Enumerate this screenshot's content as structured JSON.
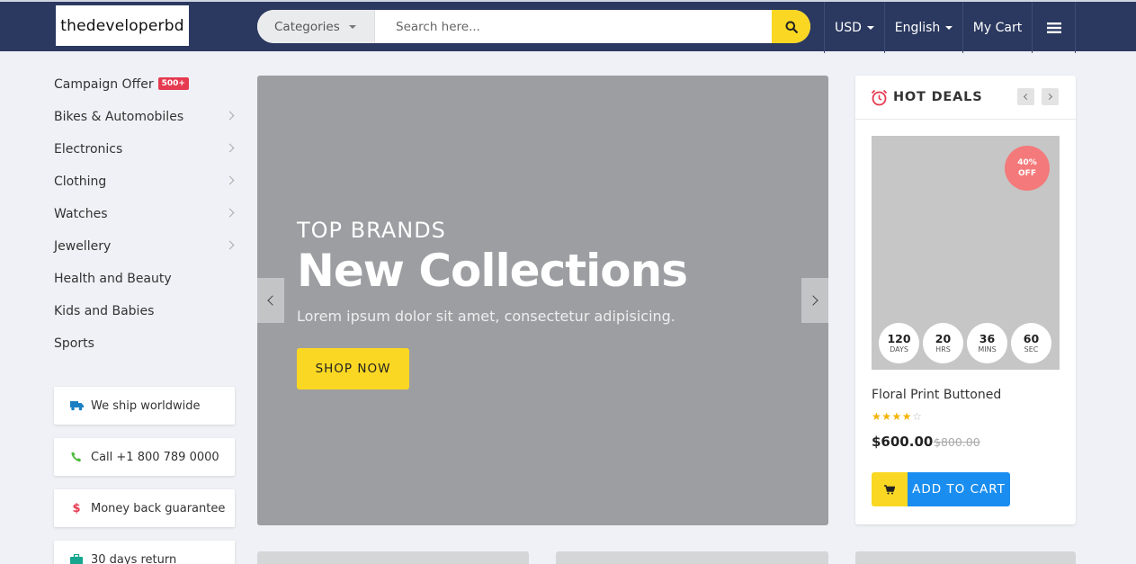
{
  "header": {
    "logo": "thedeveloperbd",
    "category_label": "Categories",
    "search_placeholder": "Search here...",
    "currency": "USD",
    "language": "English",
    "cart": "My Cart"
  },
  "sidebar": {
    "campaign": {
      "label": "Campaign Offer",
      "badge": "500+"
    },
    "items": [
      {
        "label": "Bikes & Automobiles",
        "has_sub": true
      },
      {
        "label": "Electronics",
        "has_sub": true
      },
      {
        "label": "Clothing",
        "has_sub": true
      },
      {
        "label": "Watches",
        "has_sub": true
      },
      {
        "label": "Jewellery",
        "has_sub": true
      },
      {
        "label": "Health and Beauty",
        "has_sub": false
      },
      {
        "label": "Kids and Babies",
        "has_sub": false
      },
      {
        "label": "Sports",
        "has_sub": false
      }
    ]
  },
  "features": [
    {
      "label": "We ship worldwide",
      "icon": "truck-icon",
      "color": "#1a7fc1"
    },
    {
      "label": "Call +1 800 789 0000",
      "icon": "phone-icon",
      "color": "#4cbb3a"
    },
    {
      "label": "Money back guarantee",
      "icon": "dollar-icon",
      "color": "#e63a50"
    },
    {
      "label": "30 days return",
      "icon": "briefcase-icon",
      "color": "#16a58e"
    }
  ],
  "hero": {
    "subtitle": "TOP BRANDS",
    "title": "New Collections",
    "description": "Lorem ipsum dolor sit amet, consectetur adipisicing.",
    "button": "SHOP NOW"
  },
  "hot_deals": {
    "title": "HOT DEALS",
    "discount": "40%",
    "discount_suffix": "OFF",
    "countdown": [
      {
        "value": "120",
        "unit": "DAYS"
      },
      {
        "value": "20",
        "unit": "HRS"
      },
      {
        "value": "36",
        "unit": "MINS"
      },
      {
        "value": "60",
        "unit": "SEC"
      }
    ],
    "product_name": "Floral Print Buttoned",
    "rating": 4,
    "rating_max": 5,
    "price": "$600.00",
    "old_price": "$800.00",
    "button": "ADD TO CART"
  },
  "colors": {
    "header_bg": "#2b3960",
    "accent_yellow": "#fad723",
    "accent_blue": "#1a8ef0",
    "badge_red": "#e63a50",
    "hero_bg": "#9d9ea1"
  }
}
